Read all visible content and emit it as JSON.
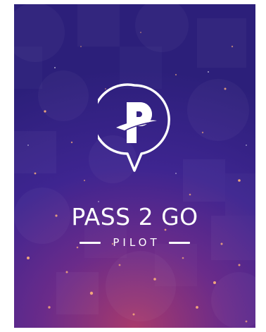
{
  "app": {
    "title": "PASS 2 GO",
    "subtitle": "PILOT",
    "logo_letter": "P"
  },
  "icons": {
    "logo": "map-pin-p-icon"
  },
  "colors": {
    "background_top": "#2c1f7a",
    "background_mid": "#3e2590",
    "background_glow": "#a83a6c",
    "foreground": "#ffffff"
  }
}
